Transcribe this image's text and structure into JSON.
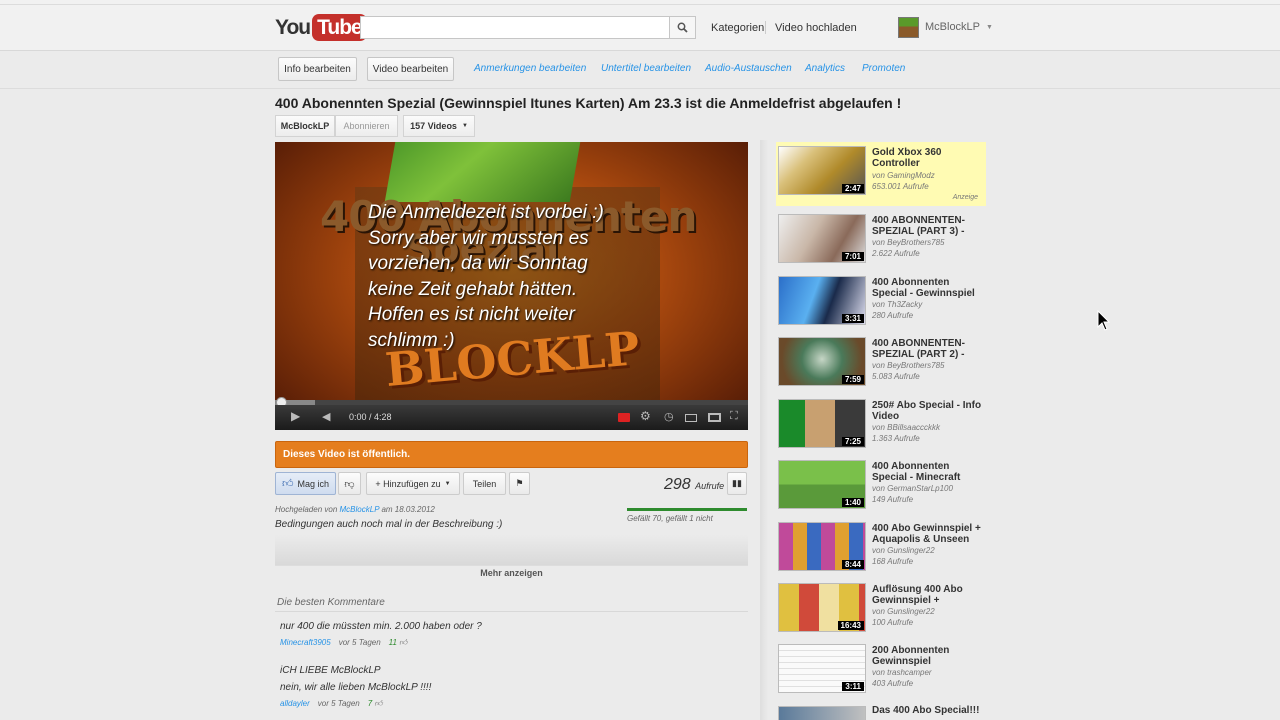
{
  "header": {
    "logo_you": "You",
    "logo_tube": "Tube",
    "search_placeholder": "",
    "links": [
      "Kategorien",
      "Video hochladen"
    ],
    "username": "McBlockLP"
  },
  "editbar": {
    "buttons": [
      "Info bearbeiten",
      "Video bearbeiten"
    ],
    "links": [
      "Anmerkungen bearbeiten",
      "Untertitel bearbeiten",
      "Audio-Austauschen",
      "Analytics",
      "Promoten"
    ]
  },
  "video": {
    "title": "400 Abonennten Spezial (Gewinnspiel Itunes Karten) Am 23.3 ist die Anmeldefrist abgelaufen !",
    "channel": "McBlockLP",
    "subscribe": "Abonnieren",
    "video_count": "157 Videos",
    "overlay_lines": [
      "Die Anmeldezeit ist vorbei :)",
      "Sorry aber wir mussten es",
      "vorziehen, da wir Sonntag",
      "keine Zeit gehabt hätten.",
      "Hoffen es ist nicht weiter",
      "schlimm :)"
    ],
    "bg_text_1": "400 Abonnenten",
    "bg_text_2": "Spezial",
    "bg_text_3": "BLOCKLP",
    "time": "0:00 / 4:28",
    "progress": 0.0
  },
  "status_banner": "Dieses Video ist öffentlich.",
  "actions": {
    "like": "Mag ich",
    "add": "+ Hinzufügen zu",
    "share": "Teilen",
    "views": "298",
    "views_label": "Aufrufe",
    "like_stats": "Gefällt 70, gefällt 1 nicht"
  },
  "description": {
    "uploaded_prefix": "Hochgeladen von",
    "uploader": "McBlockLP",
    "uploaded_date": "am 18.03.2012",
    "text": "Bedingungen auch noch mal in der Beschreibung :)",
    "more": "Mehr anzeigen"
  },
  "comments": {
    "title": "Die besten Kommentare",
    "items": [
      {
        "text": "nur 400 die müssten min. 2.000 haben oder ?",
        "text2": "",
        "user": "Minecraft3905",
        "time": "vor 5 Tagen",
        "likes": "11"
      },
      {
        "text": "iCH LIEBE McBlockLP",
        "text2": "nein, wir alle lieben McBlockLP !!!!",
        "user": "alldayler",
        "time": "vor 5 Tagen",
        "likes": "7"
      }
    ]
  },
  "recommendations": [
    {
      "title": "Gold Xbox 360 Controller",
      "by": "von GamingModz",
      "views": "653.001 Aufrufe",
      "duration": "2:47",
      "ad": "Anzeige"
    },
    {
      "title": "400 ABONNENTEN-SPEZIAL (PART 3) -",
      "by": "von BeyBrothers785",
      "views": "2.622 Aufrufe",
      "duration": "7:01"
    },
    {
      "title": "400 Abonnenten Special - Gewinnspiel",
      "by": "von Th3Zacky",
      "views": "280 Aufrufe",
      "duration": "3:31"
    },
    {
      "title": "400 ABONNENTEN-SPEZIAL (PART 2) -",
      "by": "von BeyBrothers785",
      "views": "5.083 Aufrufe",
      "duration": "7:59"
    },
    {
      "title": "250# Abo Special - Info Video",
      "by": "von BBillsaaccckkk",
      "views": "1.363 Aufrufe",
      "duration": "7:25"
    },
    {
      "title": "400 Abonnenten Special - Minecraft",
      "by": "von GermanStarLp100",
      "views": "149 Aufrufe",
      "duration": "1:40"
    },
    {
      "title": "400 Abo Gewinnspiel + Aquapolis & Unseen",
      "by": "von Gunslinger22",
      "views": "168 Aufrufe",
      "duration": "8:44"
    },
    {
      "title": "Auflösung 400 Abo Gewinnspiel +",
      "by": "von Gunslinger22",
      "views": "100 Aufrufe",
      "duration": "16:43"
    },
    {
      "title": "200 Abonnenten Gewinnspiel",
      "by": "von trashcamper",
      "views": "403 Aufrufe",
      "duration": "3:11"
    },
    {
      "title": "Das 400 Abo Special!!!",
      "by": "",
      "views": "",
      "duration": ""
    }
  ]
}
